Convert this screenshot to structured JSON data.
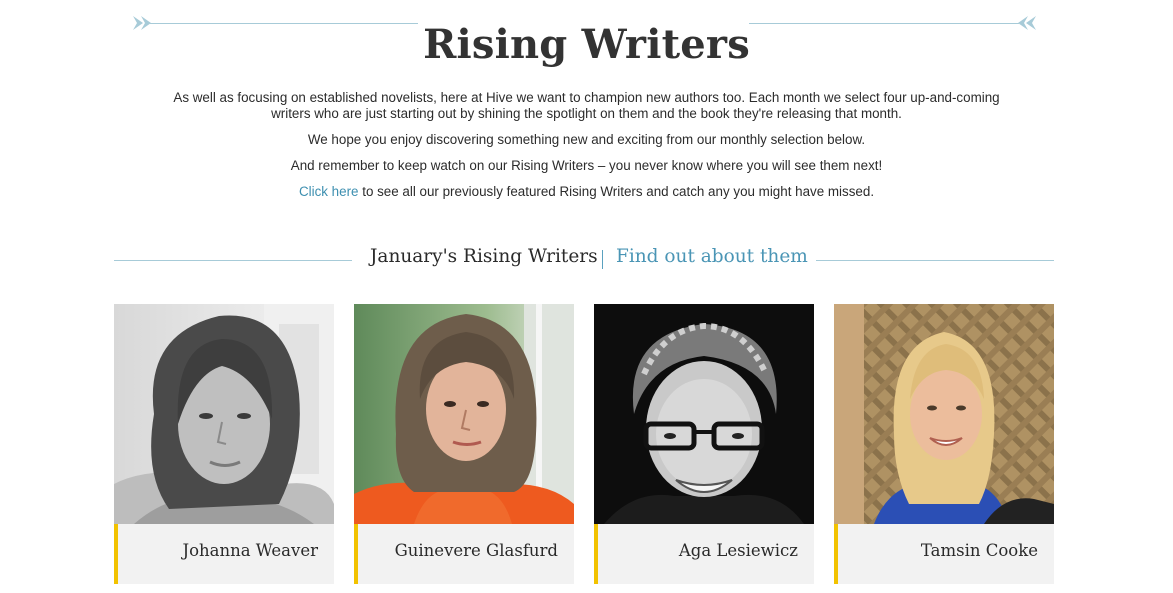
{
  "header": {
    "title": "Rising Writers"
  },
  "intro": {
    "paragraph1": "As well as focusing on established novelists, here at Hive we want to champion new authors too. Each month we select four up-and-coming writers who are just starting out by shining the spotlight on them and the book they're releasing that month.",
    "paragraph2": "We hope you enjoy discovering something new and exciting from our monthly selection below.",
    "paragraph3": "And remember to keep watch on our Rising Writers – you never know where you will see them next!",
    "paragraph4_link": "Click here",
    "paragraph4_rest": " to see all our previously featured Rising Writers and catch any you might have missed."
  },
  "section": {
    "title": "January's Rising Writers",
    "link": "Find out about them"
  },
  "writers": [
    {
      "name": "Johanna Weaver"
    },
    {
      "name": "Guinevere Glasfurd"
    },
    {
      "name": "Aga Lesiewicz"
    },
    {
      "name": "Tamsin Cooke"
    }
  ],
  "colors": {
    "accent_blue": "#4a95b5",
    "rule_blue": "#a7cbd8",
    "name_bar_border": "#f2c200",
    "name_bar_bg": "#f2f2f2"
  }
}
